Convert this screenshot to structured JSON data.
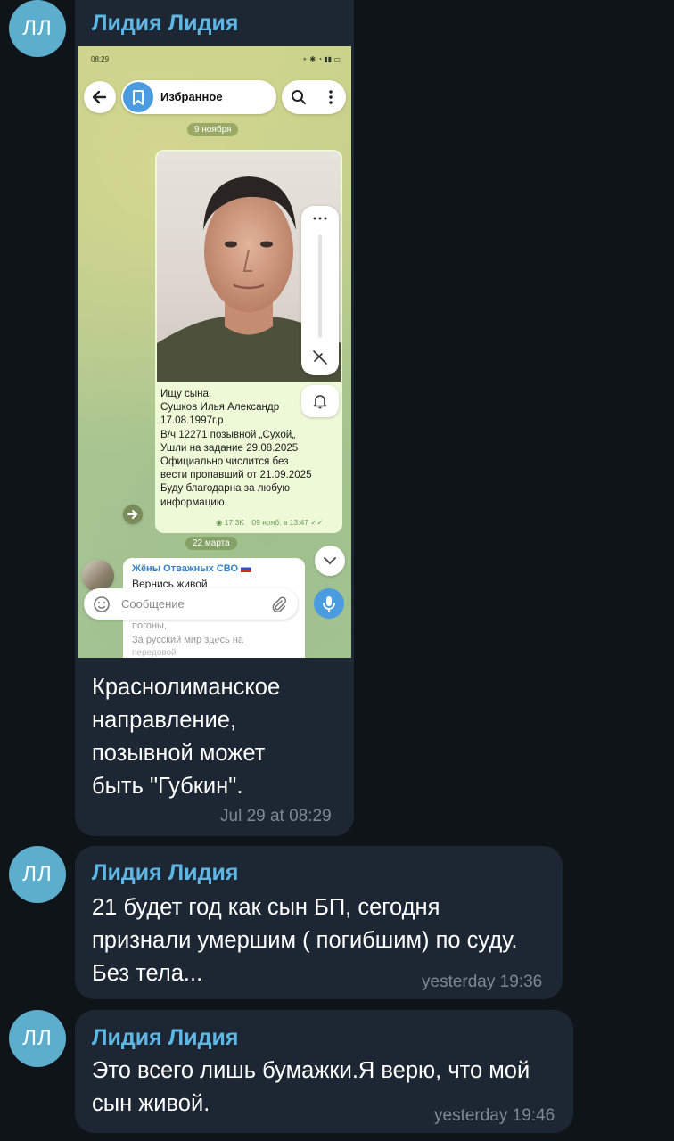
{
  "messages": [
    {
      "avatar": "ЛЛ",
      "sender": "Лидия Лидия",
      "text": "Краснолиманское\nнаправление,\nпозывной может\nбыть \"Губкин\".",
      "time": "Jul 29 at 08:29",
      "screenshot": {
        "status_time": "08:29",
        "chat_title": "Избранное",
        "date1": "9 ноября",
        "post_text": "Ищу сына.\nСушков Илья Александр\n17.08.1997г.р\nВ/ч 12271 позывной „Сухой„\nУшли на задание 29.08.2025\nОфициально числится без\nвести пропавший от 21.09.2025\nБуду благодарна за любую\nинформацию.",
        "views": "17.3K",
        "post_time": "09 нояб. в 13:47",
        "date2": "22 марта",
        "channel_name": "Жёны Отважных СВО",
        "channel_text_1": "Вернись живой",
        "channel_text_2": "погоны,",
        "channel_text_3": "За русский мир здесь на",
        "channel_text_4": "передовой",
        "input_placeholder": "Сообщение"
      }
    },
    {
      "avatar": "ЛЛ",
      "sender": "Лидия Лидия",
      "text": "21 будет год как сын БП, сегодня\nпризнали умершим ( погибшим) по суду.\nБез тела...",
      "time": "yesterday 19:36"
    },
    {
      "avatar": "ЛЛ",
      "sender": "Лидия Лидия",
      "text": "Это всего лишь бумажки.Я верю, что мой\nсын живой.",
      "time": "yesterday 19:46"
    }
  ],
  "colors": {
    "background": "#0f1419",
    "bubble": "#1d2733",
    "sender": "#5fb6e2",
    "avatar": "#5caecc",
    "time": "#7c8893"
  }
}
